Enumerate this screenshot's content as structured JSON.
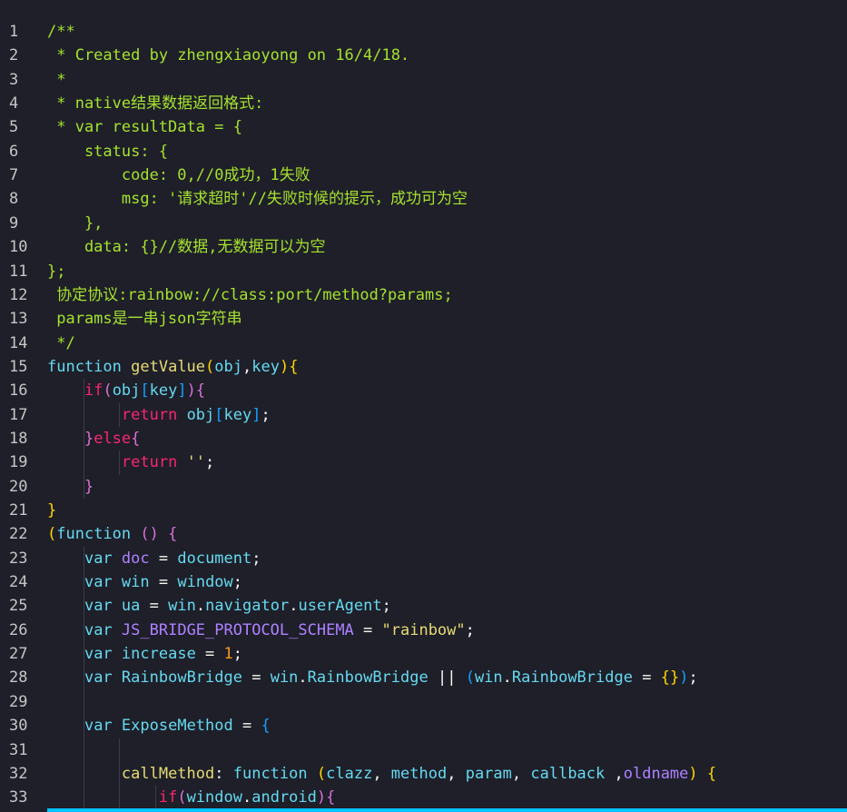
{
  "editor": {
    "lines": [
      {
        "n": "1",
        "tokens": [
          {
            "t": "/**",
            "c": "comment"
          }
        ]
      },
      {
        "n": "2",
        "tokens": [
          {
            "t": " * Created by zhengxiaoyong on 16/4/18.",
            "c": "comment"
          }
        ]
      },
      {
        "n": "3",
        "tokens": [
          {
            "t": " *",
            "c": "comment"
          }
        ]
      },
      {
        "n": "4",
        "tokens": [
          {
            "t": " * native结果数据返回格式:",
            "c": "comment"
          }
        ]
      },
      {
        "n": "5",
        "tokens": [
          {
            "t": " * var resultData = {",
            "c": "comment"
          }
        ]
      },
      {
        "n": "6",
        "tokens": [
          {
            "t": "    status: {",
            "c": "comment"
          }
        ]
      },
      {
        "n": "7",
        "tokens": [
          {
            "t": "        code: 0,//0成功，1失败",
            "c": "comment"
          }
        ]
      },
      {
        "n": "8",
        "tokens": [
          {
            "t": "        msg: '请求超时'//失败时候的提示，成功可为空",
            "c": "comment"
          }
        ]
      },
      {
        "n": "9",
        "tokens": [
          {
            "t": "    },",
            "c": "comment"
          }
        ]
      },
      {
        "n": "10",
        "tokens": [
          {
            "t": "    data: {}//数据,无数据可以为空",
            "c": "comment"
          }
        ]
      },
      {
        "n": "11",
        "tokens": [
          {
            "t": "};",
            "c": "comment"
          }
        ]
      },
      {
        "n": "12",
        "tokens": [
          {
            "t": " 协定协议:rainbow://class:port/method?params;",
            "c": "comment"
          }
        ]
      },
      {
        "n": "13",
        "tokens": [
          {
            "t": " params是一串json字符串",
            "c": "comment"
          }
        ]
      },
      {
        "n": "14",
        "tokens": [
          {
            "t": " */",
            "c": "comment"
          }
        ]
      },
      {
        "n": "15",
        "tokens": [
          {
            "t": "function",
            "c": "kw"
          },
          {
            "t": " ",
            "c": "plain"
          },
          {
            "t": "getValue",
            "c": "fn"
          },
          {
            "t": "(",
            "c": "p0"
          },
          {
            "t": "obj",
            "c": "prop"
          },
          {
            "t": ",",
            "c": "plain"
          },
          {
            "t": "key",
            "c": "prop"
          },
          {
            "t": ")",
            "c": "p0"
          },
          {
            "t": "{",
            "c": "p0"
          }
        ]
      },
      {
        "n": "16",
        "tokens": [
          {
            "t": "    ",
            "c": "plain"
          },
          {
            "t": "if",
            "c": "ctrl"
          },
          {
            "t": "(",
            "c": "p1"
          },
          {
            "t": "obj",
            "c": "prop"
          },
          {
            "t": "[",
            "c": "p2"
          },
          {
            "t": "key",
            "c": "prop"
          },
          {
            "t": "]",
            "c": "p2"
          },
          {
            "t": ")",
            "c": "p1"
          },
          {
            "t": "{",
            "c": "p1"
          }
        ]
      },
      {
        "n": "17",
        "tokens": [
          {
            "t": "        ",
            "c": "plain"
          },
          {
            "t": "return",
            "c": "ctrl"
          },
          {
            "t": " ",
            "c": "plain"
          },
          {
            "t": "obj",
            "c": "prop"
          },
          {
            "t": "[",
            "c": "p2"
          },
          {
            "t": "key",
            "c": "prop"
          },
          {
            "t": "]",
            "c": "p2"
          },
          {
            "t": ";",
            "c": "plain"
          }
        ]
      },
      {
        "n": "18",
        "tokens": [
          {
            "t": "    ",
            "c": "plain"
          },
          {
            "t": "}",
            "c": "p1"
          },
          {
            "t": "else",
            "c": "ctrl"
          },
          {
            "t": "{",
            "c": "p1"
          }
        ]
      },
      {
        "n": "19",
        "tokens": [
          {
            "t": "        ",
            "c": "plain"
          },
          {
            "t": "return",
            "c": "ctrl"
          },
          {
            "t": " ",
            "c": "plain"
          },
          {
            "t": "''",
            "c": "str"
          },
          {
            "t": ";",
            "c": "plain"
          }
        ]
      },
      {
        "n": "20",
        "tokens": [
          {
            "t": "    ",
            "c": "plain"
          },
          {
            "t": "}",
            "c": "p1"
          }
        ]
      },
      {
        "n": "21",
        "tokens": [
          {
            "t": "}",
            "c": "p0"
          }
        ]
      },
      {
        "n": "22",
        "tokens": [
          {
            "t": "(",
            "c": "p0"
          },
          {
            "t": "function",
            "c": "kw"
          },
          {
            "t": " ",
            "c": "plain"
          },
          {
            "t": "(",
            "c": "p1"
          },
          {
            "t": ")",
            "c": "p1"
          },
          {
            "t": " ",
            "c": "plain"
          },
          {
            "t": "{",
            "c": "p1"
          }
        ]
      },
      {
        "n": "23",
        "tokens": [
          {
            "t": "    ",
            "c": "plain"
          },
          {
            "t": "var",
            "c": "kw"
          },
          {
            "t": " ",
            "c": "plain"
          },
          {
            "t": "doc",
            "c": "var"
          },
          {
            "t": " = ",
            "c": "op"
          },
          {
            "t": "document",
            "c": "prop"
          },
          {
            "t": ";",
            "c": "plain"
          }
        ]
      },
      {
        "n": "24",
        "tokens": [
          {
            "t": "    ",
            "c": "plain"
          },
          {
            "t": "var",
            "c": "kw"
          },
          {
            "t": " ",
            "c": "plain"
          },
          {
            "t": "win",
            "c": "prop"
          },
          {
            "t": " = ",
            "c": "op"
          },
          {
            "t": "window",
            "c": "prop"
          },
          {
            "t": ";",
            "c": "plain"
          }
        ]
      },
      {
        "n": "25",
        "tokens": [
          {
            "t": "    ",
            "c": "plain"
          },
          {
            "t": "var",
            "c": "kw"
          },
          {
            "t": " ",
            "c": "plain"
          },
          {
            "t": "ua",
            "c": "prop"
          },
          {
            "t": " = ",
            "c": "op"
          },
          {
            "t": "win",
            "c": "prop"
          },
          {
            "t": ".",
            "c": "plain"
          },
          {
            "t": "navigator",
            "c": "prop"
          },
          {
            "t": ".",
            "c": "plain"
          },
          {
            "t": "userAgent",
            "c": "prop"
          },
          {
            "t": ";",
            "c": "plain"
          }
        ]
      },
      {
        "n": "26",
        "tokens": [
          {
            "t": "    ",
            "c": "plain"
          },
          {
            "t": "var",
            "c": "kw"
          },
          {
            "t": " ",
            "c": "plain"
          },
          {
            "t": "JS_BRIDGE_PROTOCOL_SCHEMA",
            "c": "var"
          },
          {
            "t": " = ",
            "c": "op"
          },
          {
            "t": "\"rainbow\"",
            "c": "str"
          },
          {
            "t": ";",
            "c": "plain"
          }
        ]
      },
      {
        "n": "27",
        "tokens": [
          {
            "t": "    ",
            "c": "plain"
          },
          {
            "t": "var",
            "c": "kw"
          },
          {
            "t": " ",
            "c": "plain"
          },
          {
            "t": "increase",
            "c": "prop"
          },
          {
            "t": " = ",
            "c": "op"
          },
          {
            "t": "1",
            "c": "num"
          },
          {
            "t": ";",
            "c": "plain"
          }
        ]
      },
      {
        "n": "28",
        "tokens": [
          {
            "t": "    ",
            "c": "plain"
          },
          {
            "t": "var",
            "c": "kw"
          },
          {
            "t": " ",
            "c": "plain"
          },
          {
            "t": "RainbowBridge",
            "c": "prop"
          },
          {
            "t": " = ",
            "c": "op"
          },
          {
            "t": "win",
            "c": "prop"
          },
          {
            "t": ".",
            "c": "plain"
          },
          {
            "t": "RainbowBridge",
            "c": "prop"
          },
          {
            "t": " || ",
            "c": "op"
          },
          {
            "t": "(",
            "c": "p2"
          },
          {
            "t": "win",
            "c": "prop"
          },
          {
            "t": ".",
            "c": "plain"
          },
          {
            "t": "RainbowBridge",
            "c": "prop"
          },
          {
            "t": " = ",
            "c": "op"
          },
          {
            "t": "{",
            "c": "p0"
          },
          {
            "t": "}",
            "c": "p0"
          },
          {
            "t": ")",
            "c": "p2"
          },
          {
            "t": ";",
            "c": "plain"
          }
        ]
      },
      {
        "n": "29",
        "tokens": []
      },
      {
        "n": "30",
        "tokens": [
          {
            "t": "    ",
            "c": "plain"
          },
          {
            "t": "var",
            "c": "kw"
          },
          {
            "t": " ",
            "c": "plain"
          },
          {
            "t": "ExposeMethod",
            "c": "prop"
          },
          {
            "t": " = ",
            "c": "op"
          },
          {
            "t": "{",
            "c": "p2"
          }
        ]
      },
      {
        "n": "31",
        "tokens": []
      },
      {
        "n": "32",
        "tokens": [
          {
            "t": "        ",
            "c": "plain"
          },
          {
            "t": "callMethod",
            "c": "fn"
          },
          {
            "t": ": ",
            "c": "plain"
          },
          {
            "t": "function",
            "c": "kw"
          },
          {
            "t": " ",
            "c": "plain"
          },
          {
            "t": "(",
            "c": "p0"
          },
          {
            "t": "clazz",
            "c": "prop"
          },
          {
            "t": ", ",
            "c": "plain"
          },
          {
            "t": "method",
            "c": "prop"
          },
          {
            "t": ", ",
            "c": "plain"
          },
          {
            "t": "param",
            "c": "prop"
          },
          {
            "t": ", ",
            "c": "plain"
          },
          {
            "t": "callback",
            "c": "prop"
          },
          {
            "t": " ,",
            "c": "plain"
          },
          {
            "t": "oldname",
            "c": "var"
          },
          {
            "t": ")",
            "c": "p0"
          },
          {
            "t": " ",
            "c": "plain"
          },
          {
            "t": "{",
            "c": "p0"
          }
        ]
      },
      {
        "n": "33",
        "tokens": [
          {
            "t": "            ",
            "c": "plain"
          },
          {
            "t": "if",
            "c": "ctrl"
          },
          {
            "t": "(",
            "c": "p1"
          },
          {
            "t": "window",
            "c": "prop"
          },
          {
            "t": ".",
            "c": "plain"
          },
          {
            "t": "android",
            "c": "prop"
          },
          {
            "t": ")",
            "c": "p1"
          },
          {
            "t": "{",
            "c": "p1"
          }
        ]
      }
    ]
  }
}
